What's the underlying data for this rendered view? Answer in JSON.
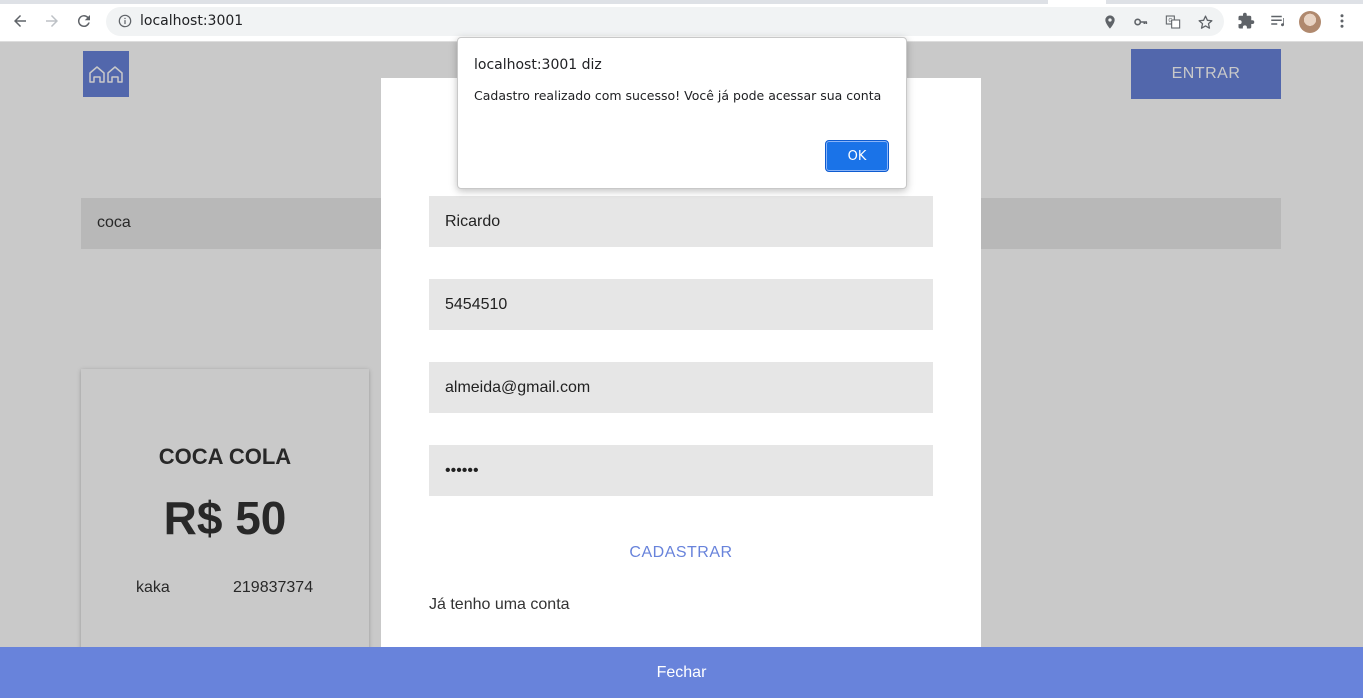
{
  "browser": {
    "url": "localhost:3001"
  },
  "header": {
    "enter_label": "ENTRAR"
  },
  "search": {
    "value": "coca"
  },
  "card": {
    "title": "COCA COLA",
    "price": "R$ 50",
    "user": "kaka",
    "phone": "219837374"
  },
  "signup_modal": {
    "name_value": "Ricardo",
    "phone_value": "5454510",
    "email_value": "almeida@gmail.com",
    "password_value": "••••••",
    "submit_label": "CADASTRAR",
    "have_account_label": "Já tenho uma conta",
    "close_label": "Fechar"
  },
  "alert": {
    "title": "localhost:3001 diz",
    "message": "Cadastro realizado com sucesso! Você já pode acessar sua conta",
    "ok_label": "OK"
  },
  "colors": {
    "accent": "#6883db",
    "dialog_button": "#1a73e8"
  }
}
